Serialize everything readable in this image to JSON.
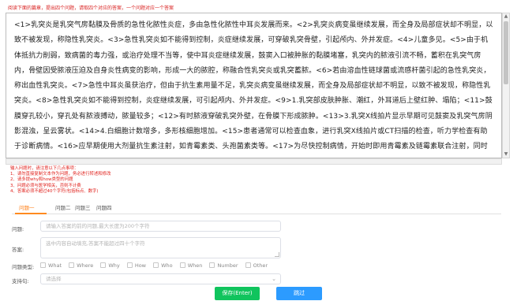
{
  "instruction": "阅读下面的篇章，提出四个问题，请取四个对应的答案，一个问题对应一个答案",
  "passage": "<1>乳突炎是乳突气房黏膜及骨质的急性化脓性炎症，多由急性化脓性中耳炎发展而来。<2>乳突炎病变虽继续发展，而全身及局部症状却不明显，以致不被发现，称隐性乳突炎。<3>急性乳突炎如不能得到控制，炎症继续发展，可穿破乳突骨壁，引起颅内、外并发症。<4>儿童多见。<5>由于机体抵抗力削弱，致病菌的毒力强，或治疗处理不当等，使中耳炎症继续发展，鼓窦入口被肿胀的黏膜堵塞，乳突内的脓液引流不畅，蓄积在乳突气房内，骨壁因受脓液压迫及自身炎性病变的影响，形成一大的脓腔，称融合性乳突炎或乳突蓄脓。<6>若由溶血性链球菌或流感杆菌引起的急性乳突炎，称出血性乳突炎。<7>急性中耳炎虽获治疗，但由于抗生素用量不足，乳突炎病变虽继续发展，而全身及局部症状却不明显，以致不被发现，称隐性乳突炎。<8>急性乳突炎如不能得到控制，炎症继续发展，可引起颅内、外并发症。<9>1.乳突部皮肤肿胀、潮红，外耳道后上壁红肿、塌陷；<11>鼓膜穿孔较小，穿孔处有脓液搏动，脓量较多；<12>有时脓液穿破乳突外壁，在骨膜下形成脓肿。<13>3.乳突X线拍片显示早期可见鼓窦及乳突气房阴影混浊，呈云雾状。<14>4.白细胞计数增多，多形核细胞增加。<15>患者通常可以检查血象，进行乳突X线拍片或CT扫描的检查，听力学检查有助于诊断病情。<16>应早期使用大剂量抗生素注射，如青霉素类、头孢菌素类等。<17>为尽快控制病情，开始时即用青霉素及链霉素联合注射，同时取耳道分泌物作细菌培养及药敏试验，以便及时调整抗生素。",
  "notes": {
    "title": "输入问题时，请注意以下几点事项：",
    "items": [
      "1、请勿直接复制文本作为问题，务必进行转述和修改",
      "2、请多提why和how类型的问题",
      "3、问题必须与医学相关，否则不计费",
      "4、答案必须不超过40个字符(包括标点、数字)"
    ]
  },
  "tabs": [
    "问题一",
    "问题二",
    "问题三",
    "问题四"
  ],
  "form": {
    "question_label": "问题:",
    "question_placeholder": "请输入答案的前的问题,最大长度为200个字符",
    "answer_label": "答案:",
    "answer_placeholder": "选中内容自动填充,答案不能超过四十个字符",
    "type_label": "问题类型:",
    "types": [
      "What",
      "Where",
      "Why",
      "How",
      "Who",
      "When",
      "Number",
      "Other"
    ],
    "support_label": "支持句:",
    "support_placeholder": "请选择"
  },
  "buttons": {
    "save": "保存(Enter)",
    "skip": "跳过"
  },
  "colors": {
    "accent": "#ff7e14",
    "save": "#10c45d",
    "skip": "#2c9bff",
    "warning": "#d9201f"
  }
}
